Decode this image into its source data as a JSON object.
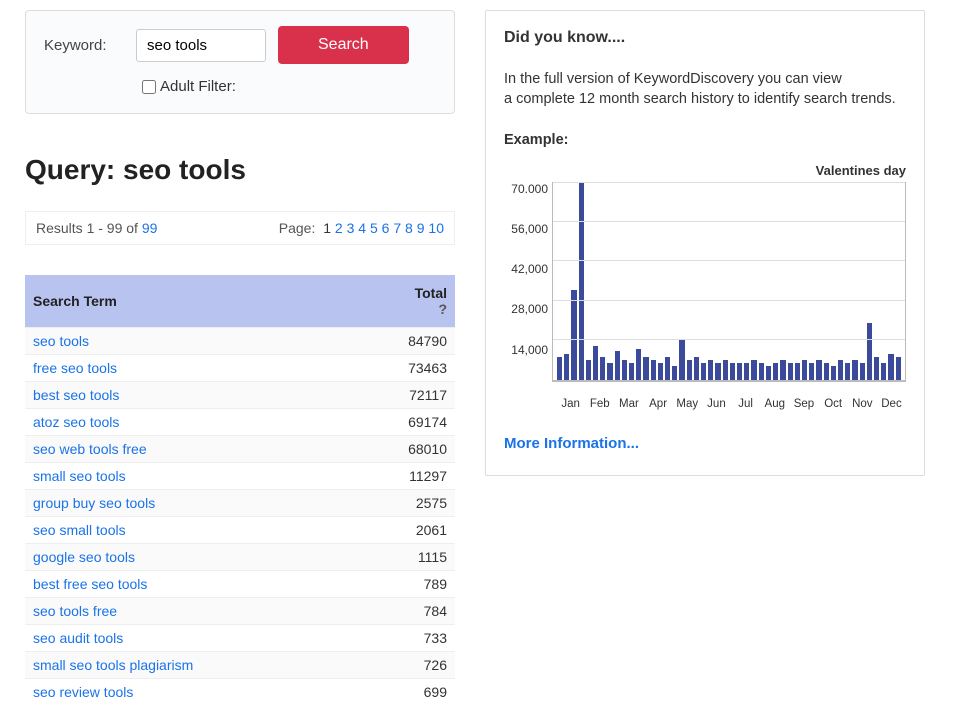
{
  "search": {
    "label": "Keyword:",
    "value": "seo tools",
    "button": "Search",
    "filter_label": "Adult Filter:"
  },
  "query": {
    "title_prefix": "Query: ",
    "term": "seo tools"
  },
  "results": {
    "text": "Results 1 - 99 of ",
    "total": "99",
    "page_label": "Page: ",
    "pages": [
      "1",
      "2",
      "3",
      "4",
      "5",
      "6",
      "7",
      "8",
      "9",
      "10"
    ],
    "current_page": "1"
  },
  "table": {
    "header_term": "Search Term",
    "header_total": "Total",
    "header_help": "?",
    "rows": [
      {
        "term": "seo tools",
        "total": "84790"
      },
      {
        "term": "free seo tools",
        "total": "73463"
      },
      {
        "term": "best seo tools",
        "total": "72117"
      },
      {
        "term": "atoz seo tools",
        "total": "69174"
      },
      {
        "term": "seo web tools free",
        "total": "68010"
      },
      {
        "term": "small seo tools",
        "total": "11297"
      },
      {
        "term": "group buy seo tools",
        "total": "2575"
      },
      {
        "term": "seo small tools",
        "total": "2061"
      },
      {
        "term": "google seo tools",
        "total": "1115"
      },
      {
        "term": "best free seo tools",
        "total": "789"
      },
      {
        "term": "seo tools free",
        "total": "784"
      },
      {
        "term": "seo audit tools",
        "total": "733"
      },
      {
        "term": "small seo tools plagiarism",
        "total": "726"
      },
      {
        "term": "seo review tools",
        "total": "699"
      }
    ]
  },
  "info": {
    "did_you_know": "Did you know....",
    "line1": "In the full version of KeywordDiscovery you can view",
    "line2": "a complete 12 month search history to identify search trends.",
    "example": "Example:",
    "chart_title": "Valentines day",
    "more": "More Information..."
  },
  "chart_data": {
    "type": "bar",
    "title": "Valentines day",
    "xlabel": "",
    "ylabel": "",
    "ylim": [
      0,
      70000
    ],
    "yticks": [
      70000,
      56000,
      42000,
      28000,
      14000
    ],
    "ytick_labels": [
      "70.000",
      "56,000",
      "42,000",
      "28,000",
      "14,000"
    ],
    "months": [
      "Jan",
      "Feb",
      "Mar",
      "Apr",
      "May",
      "Jun",
      "Jul",
      "Aug",
      "Sep",
      "Oct",
      "Nov",
      "Dec"
    ],
    "values": [
      8000,
      9000,
      32000,
      70000,
      7000,
      12000,
      8000,
      6000,
      10000,
      7000,
      6000,
      11000,
      8000,
      7000,
      6000,
      8000,
      5000,
      14000,
      7000,
      8000,
      6000,
      7000,
      6000,
      7000,
      6000,
      6000,
      6000,
      7000,
      6000,
      5000,
      6000,
      7000,
      6000,
      6000,
      7000,
      6000,
      7000,
      6000,
      5000,
      7000,
      6000,
      7000,
      6000,
      20000,
      8000,
      6000,
      9000,
      8000
    ]
  }
}
